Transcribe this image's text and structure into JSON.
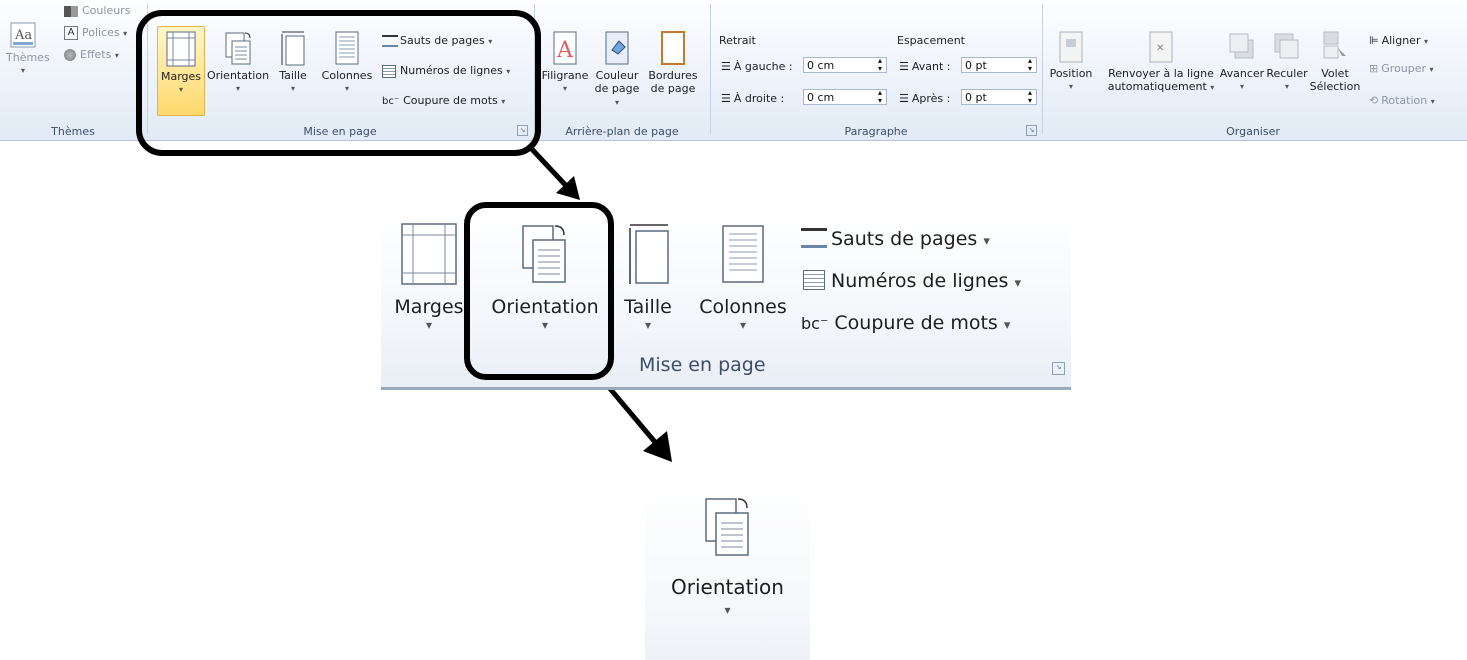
{
  "ribbon": {
    "themes": {
      "group_label": "Thèmes",
      "themes_btn": "Thèmes",
      "couleurs": "Couleurs",
      "polices": "Polices",
      "effets": "Effets"
    },
    "mise_en_page": {
      "group_label": "Mise en page",
      "marges": "Marges",
      "orientation": "Orientation",
      "taille": "Taille",
      "colonnes": "Colonnes",
      "sauts": "Sauts de pages",
      "numeros": "Numéros de lignes",
      "coupure": "Coupure de mots"
    },
    "arriere_plan": {
      "group_label": "Arrière-plan de page",
      "filigrane": "Filigrane",
      "couleur_l1": "Couleur",
      "couleur_l2": "de page",
      "bordures_l1": "Bordures",
      "bordures_l2": "de page"
    },
    "paragraphe": {
      "group_label": "Paragraphe",
      "retrait": "Retrait",
      "gauche_label": "À gauche :",
      "gauche_value": "0 cm",
      "droite_label": "À droite :",
      "droite_value": "0 cm",
      "espacement": "Espacement",
      "avant_label": "Avant :",
      "avant_value": "0 pt",
      "apres_label": "Après :",
      "apres_value": "0 pt"
    },
    "organiser": {
      "group_label": "Organiser",
      "position": "Position",
      "renvoyer_l1": "Renvoyer à la ligne",
      "renvoyer_l2": "automatiquement",
      "avancer": "Avancer",
      "reculer": "Reculer",
      "volet_l1": "Volet",
      "volet_l2": "Sélection",
      "aligner": "Aligner",
      "grouper": "Grouper",
      "rotation": "Rotation"
    }
  },
  "zoom1": {
    "marges": "Marges",
    "orientation": "Orientation",
    "taille": "Taille",
    "colonnes": "Colonnes",
    "sauts": "Sauts de pages",
    "numeros": "Numéros de lignes",
    "coupure": "Coupure de mots",
    "group_label": "Mise en page"
  },
  "zoom2": {
    "orientation": "Orientation"
  }
}
